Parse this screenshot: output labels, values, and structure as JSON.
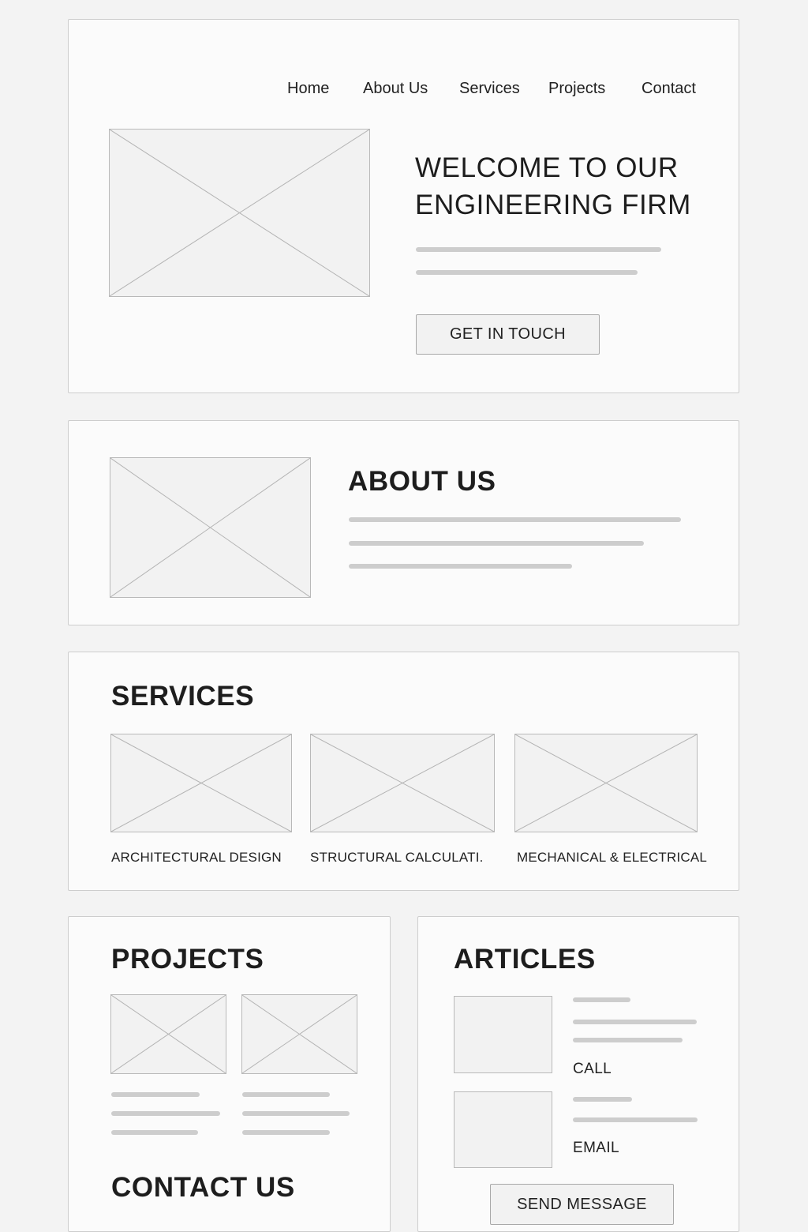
{
  "nav": {
    "items": [
      {
        "label": "Home"
      },
      {
        "label": "About Us"
      },
      {
        "label": "Services"
      },
      {
        "label": "Projects"
      },
      {
        "label": "Contact"
      }
    ]
  },
  "hero": {
    "title_line1": "WELCOME TO OUR",
    "title_line2": "ENGINEERING FIRM",
    "cta_label": "GET IN TOUCH"
  },
  "about": {
    "title": "ABOUT US"
  },
  "services": {
    "title": "SERVICES",
    "items": [
      {
        "label": "ARCHITECTURAL DESIGN"
      },
      {
        "label": "STRUCTURAL CALCULATI."
      },
      {
        "label": "MECHANICAL & ELECTRICAL"
      }
    ]
  },
  "projects": {
    "title": "PROJECTS"
  },
  "contact": {
    "title": "CONTACT US"
  },
  "articles": {
    "title": "ARTICLES",
    "call_label": "CALL",
    "email_label": "EMAIL",
    "send_label": "SEND MESSAGE"
  },
  "colors": {
    "page_background": "#f3f3f3",
    "panel_background": "#fbfbfb",
    "panel_border": "#cdcdcd",
    "placeholder_fill": "#f2f2f2",
    "text_line": "#cdcdcd",
    "text": "#1f1f1f"
  }
}
